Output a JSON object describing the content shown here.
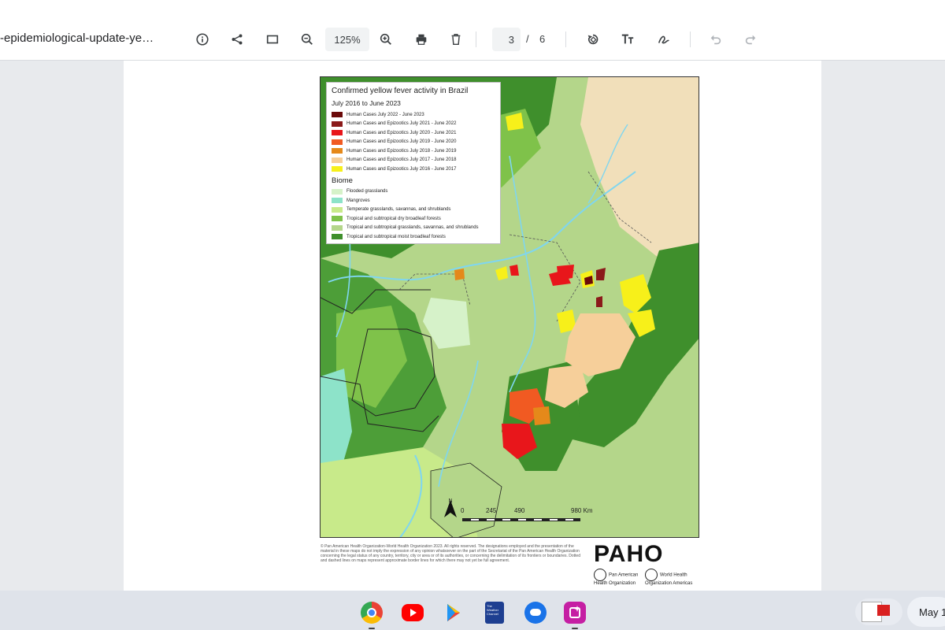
{
  "toolbar": {
    "doc_title": "-epidemiological-update-ye…",
    "zoom": "125%",
    "page_current": "3",
    "page_separator": "/",
    "page_total": "6",
    "icons": [
      "info-icon",
      "share-icon",
      "fit-page-icon",
      "zoom-out-icon",
      "zoom-in-icon",
      "print-icon",
      "delete-icon",
      "rotate-icon",
      "text-icon",
      "draw-icon",
      "undo-icon",
      "redo-icon"
    ]
  },
  "map": {
    "title": "Confirmed yellow fever activity in Brazil",
    "subtitle": "July 2016 to June 2023",
    "cases_legend": [
      {
        "label": "Human Cases July 2022 - June 2023",
        "color": "#6b0a0a"
      },
      {
        "label": "Human Cases and Epizootics July 2021 - June 2022",
        "color": "#8b1a1a"
      },
      {
        "label": "Human Cases and Epizootics July 2020 - June 2021",
        "color": "#e8161b"
      },
      {
        "label": "Human Cases and Epizootics July 2019 - June 2020",
        "color": "#f15a22"
      },
      {
        "label": "Human Cases and Epizootics July 2018 - June 2019",
        "color": "#e5891a"
      },
      {
        "label": "Human Cases and Epizootics July 2017 - June 2018",
        "color": "#f6cf9a"
      },
      {
        "label": "Human Cases and Epizootics July 2016 - June 2017",
        "color": "#f7f01a"
      }
    ],
    "biome_heading": "Biome",
    "biome_legend": [
      {
        "label": "Flooded grasslands",
        "color": "#d6f2c9"
      },
      {
        "label": "Mangroves",
        "color": "#8de3c9"
      },
      {
        "label": "Temperate grasslands, savannas, and shrublands",
        "color": "#c8ea8a"
      },
      {
        "label": "Tropical and subtropical dry broadleaf forests",
        "color": "#7fc24a"
      },
      {
        "label": "Tropical and subtropical grasslands, savannas, and shrublands",
        "color": "#b4d68a"
      },
      {
        "label": "Tropical and subtropical moist broadleaf forests",
        "color": "#3f8f2c"
      }
    ],
    "scale": {
      "labels": [
        "0",
        "245",
        "490",
        "980 Km"
      ]
    },
    "north_label": "N"
  },
  "footer": {
    "disclaimer": "© Pan American Health Organization-World Health Organization 2023. All rights reserved. The designations employed and the presentation of the material in these maps do not imply the expression of any opinion whatsoever on the part of the Secretariat of the Pan American Health Organization concerning the legal status of any country, territory, city or area or of its authorities, or concerning the delimitation of its frontiers or boundaries. Dotted and dashed lines on maps represent approximate border lines for which there may not yet be full agreement.",
    "logo_text": "PAHO",
    "org1": "Pan American Health Organization",
    "org2": "World Health Organization Americas"
  },
  "shelf": {
    "apps": [
      "chrome-icon",
      "youtube-icon",
      "play-store-icon",
      "weather-channel-icon",
      "messages-icon",
      "screencast-icon"
    ],
    "date": "May 1"
  }
}
